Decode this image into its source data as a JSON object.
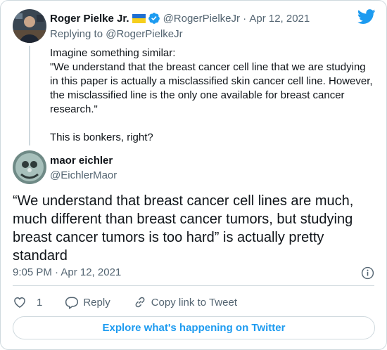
{
  "quoted_tweet": {
    "author_name": "Roger Pielke Jr.",
    "author_handle": "@RogerPielkeJr",
    "separator": " · ",
    "date": "Apr 12, 2021",
    "replying_to": "Replying to @RogerPielkeJr",
    "text_lines": [
      "Imagine something similar:",
      "\"We understand that the breast cancer cell line that we are studying in this paper is actually a misclassified skin cancer cell line. However, the misclassified line is the only one available for breast cancer research.\"",
      "This is bonkers, right?"
    ],
    "flag_colors": [
      "#1f6fd1",
      "#f6cf1d"
    ],
    "verified_icon": "verified-badge-icon"
  },
  "main_tweet": {
    "author_name": "maor eichler",
    "author_handle": "@EichlerMaor",
    "text": "“We understand that breast cancer cell lines are much, much different than breast cancer tumors, but studying breast cancer tumors is too hard” is actually pretty standard",
    "timestamp": "9:05 PM · Apr 12, 2021"
  },
  "actions": {
    "like_count": "1",
    "reply_label": "Reply",
    "copy_link_label": "Copy link to Tweet"
  },
  "explore_button": "Explore what's happening on Twitter",
  "colors": {
    "accent": "#1d9bf0",
    "muted": "#536471",
    "text": "#0f1419",
    "border": "#cfd9de"
  },
  "icons": [
    "twitter-logo-icon",
    "verified-badge-icon",
    "info-icon",
    "heart-icon",
    "reply-bubble-icon",
    "link-icon"
  ]
}
